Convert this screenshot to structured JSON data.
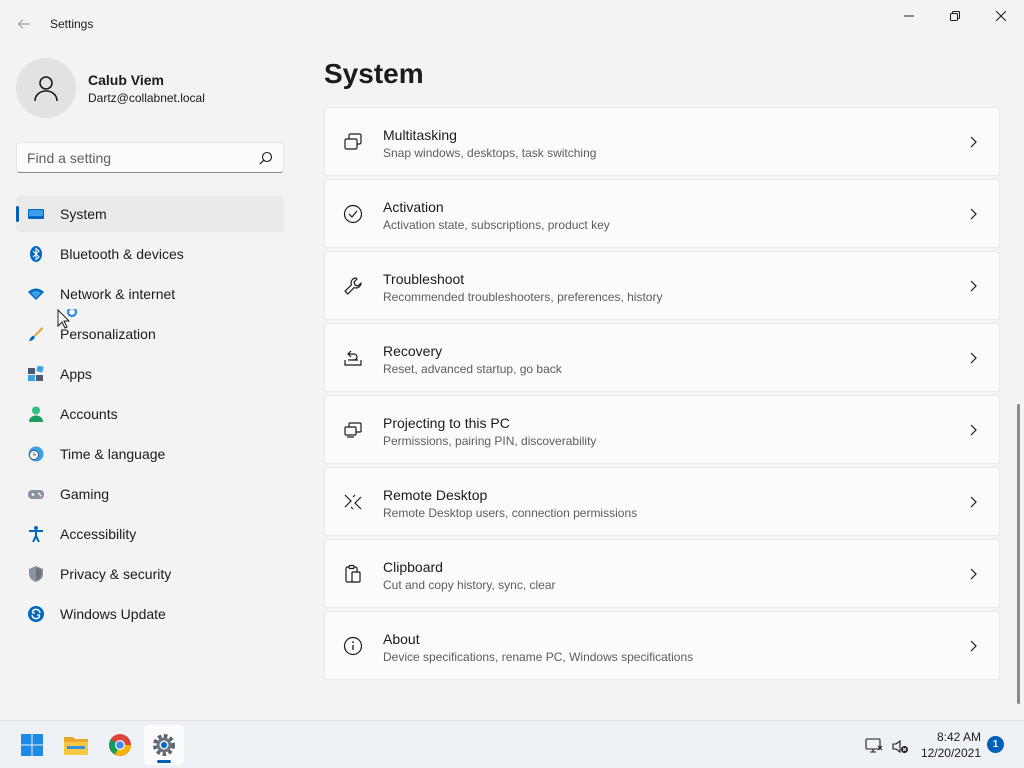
{
  "window": {
    "title": "Settings"
  },
  "profile": {
    "name": "Calub Viem",
    "email": "Dartz@collabnet.local"
  },
  "search": {
    "placeholder": "Find a setting"
  },
  "sidebar": {
    "items": [
      {
        "label": "System",
        "icon": "system-icon",
        "selected": true
      },
      {
        "label": "Bluetooth & devices",
        "icon": "bluetooth-icon"
      },
      {
        "label": "Network & internet",
        "icon": "wifi-icon"
      },
      {
        "label": "Personalization",
        "icon": "brush-icon"
      },
      {
        "label": "Apps",
        "icon": "apps-icon"
      },
      {
        "label": "Accounts",
        "icon": "accounts-icon"
      },
      {
        "label": "Time & language",
        "icon": "clock-globe-icon"
      },
      {
        "label": "Gaming",
        "icon": "gamepad-icon"
      },
      {
        "label": "Accessibility",
        "icon": "accessibility-icon"
      },
      {
        "label": "Privacy & security",
        "icon": "shield-icon"
      },
      {
        "label": "Windows Update",
        "icon": "update-icon"
      }
    ]
  },
  "main": {
    "title": "System",
    "cards": [
      {
        "title": "Multitasking",
        "subtitle": "Snap windows, desktops, task switching",
        "icon": "multitasking-icon"
      },
      {
        "title": "Activation",
        "subtitle": "Activation state, subscriptions, product key",
        "icon": "check-circle-icon"
      },
      {
        "title": "Troubleshoot",
        "subtitle": "Recommended troubleshooters, preferences, history",
        "icon": "wrench-icon"
      },
      {
        "title": "Recovery",
        "subtitle": "Reset, advanced startup, go back",
        "icon": "recovery-icon"
      },
      {
        "title": "Projecting to this PC",
        "subtitle": "Permissions, pairing PIN, discoverability",
        "icon": "projecting-icon"
      },
      {
        "title": "Remote Desktop",
        "subtitle": "Remote Desktop users, connection permissions",
        "icon": "remote-desktop-icon"
      },
      {
        "title": "Clipboard",
        "subtitle": "Cut and copy history, sync, clear",
        "icon": "clipboard-icon"
      },
      {
        "title": "About",
        "subtitle": "Device specifications, rename PC, Windows specifications",
        "icon": "info-icon"
      }
    ]
  },
  "taskbar": {
    "apps": [
      "windows-start-icon",
      "file-explorer-icon",
      "chrome-icon",
      "settings-gear-icon"
    ],
    "clock": {
      "time": "8:42 AM",
      "date": "12/20/2021"
    },
    "notifications": "1"
  },
  "colors": {
    "accent": "#005fb8",
    "background": "#f3f3f3",
    "card": "#fbfbfb"
  }
}
